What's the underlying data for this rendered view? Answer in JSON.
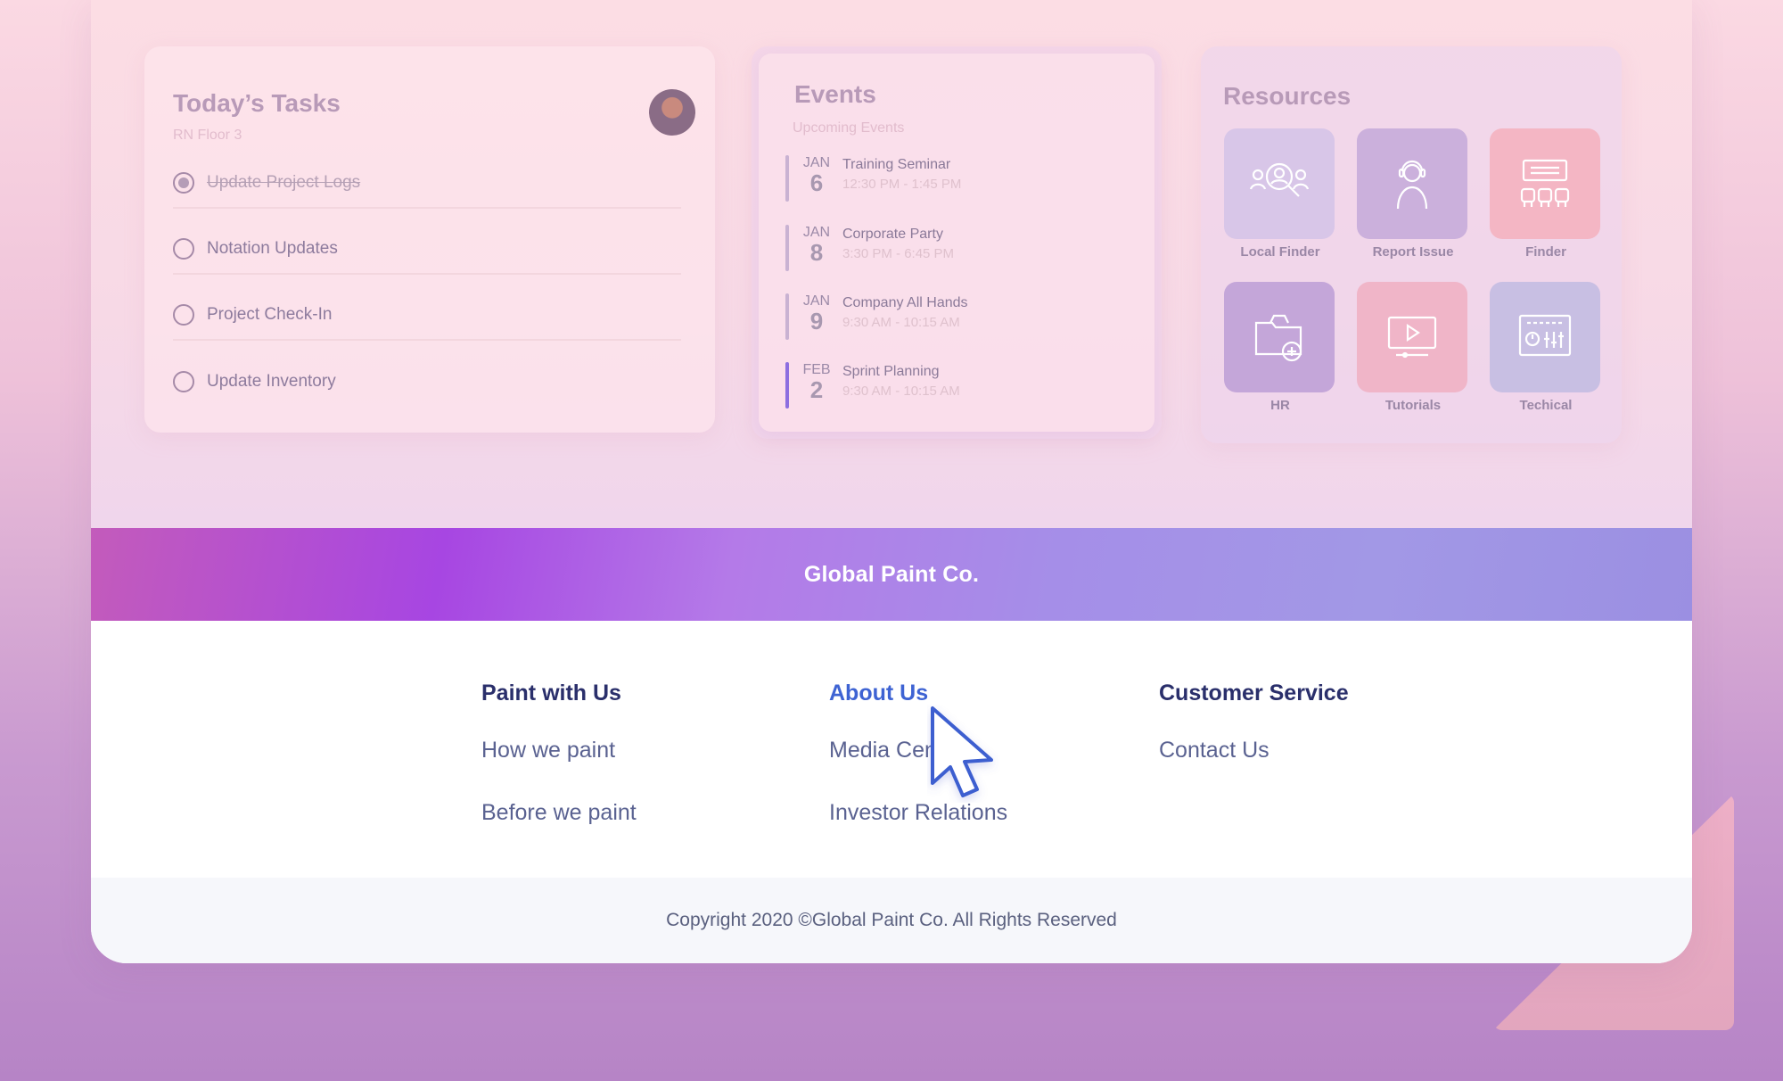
{
  "tasks": {
    "title": "Today’s Tasks",
    "subtitle": "RN Floor 3",
    "items": [
      {
        "label": "Update Project Logs",
        "done": true
      },
      {
        "label": "Notation Updates",
        "done": false
      },
      {
        "label": "Project Check-In",
        "done": false
      },
      {
        "label": "Update Inventory",
        "done": false
      }
    ]
  },
  "events": {
    "title": "Events",
    "subtitle": "Upcoming Events",
    "items": [
      {
        "month": "JAN",
        "day": "6",
        "name": "Training Seminar",
        "time": "12:30 PM - 1:45 PM"
      },
      {
        "month": "JAN",
        "day": "8",
        "name": "Corporate Party",
        "time": "3:30 PM - 6:45 PM"
      },
      {
        "month": "JAN",
        "day": "9",
        "name": "Company All Hands",
        "time": "9:30 AM - 10:15 AM"
      },
      {
        "month": "FEB",
        "day": "2",
        "name": "Sprint Planning",
        "time": "9:30 AM - 10:15 AM"
      }
    ]
  },
  "resources": {
    "title": "Resources",
    "items": [
      {
        "label": "Local Finder",
        "icon": "people-search-icon",
        "color": "#d8c6e8"
      },
      {
        "label": "Report Issue",
        "icon": "support-agent-icon",
        "color": "#cbb0dc"
      },
      {
        "label": "Finder",
        "icon": "seating-chart-icon",
        "color": "#f4b6c4"
      },
      {
        "label": "HR",
        "icon": "folder-add-icon",
        "color": "#c4a6d9"
      },
      {
        "label": "Tutorials",
        "icon": "video-tutorial-icon",
        "color": "#f0b5c8"
      },
      {
        "label": "Techical",
        "icon": "control-panel-icon",
        "color": "#c8bfe3"
      }
    ]
  },
  "banner": {
    "brand": "Global Paint Co."
  },
  "footer_links": {
    "col1": {
      "heading": "Paint with Us",
      "links": [
        "How we paint",
        "Before we paint"
      ]
    },
    "col2": {
      "heading": "About Us",
      "links": [
        "Media Center",
        "Investor Relations"
      ]
    },
    "col3": {
      "heading": "Customer Service",
      "links": [
        "Contact Us"
      ]
    }
  },
  "copyright": "Copyright 2020 ©Global Paint Co. All Rights Reserved"
}
